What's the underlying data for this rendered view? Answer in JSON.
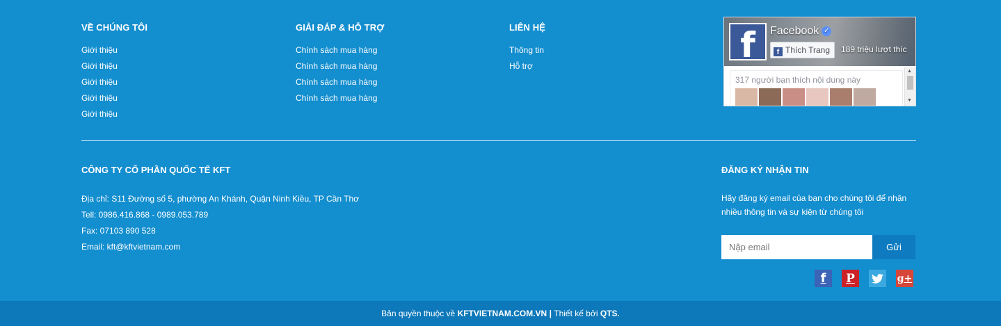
{
  "columns": [
    {
      "title": "VỀ CHÚNG TÔI",
      "links": [
        "Giới thiệu",
        "Giới thiệu",
        "Giới thiệu",
        "Giới thiệu",
        "Giới thiệu"
      ]
    },
    {
      "title": "GIẢI ĐÁP & HỖ TRỢ",
      "links": [
        "Chính sách mua hàng",
        "Chính sách mua hàng",
        "Chính sách mua hàng",
        "Chính sách mua hàng"
      ]
    },
    {
      "title": "LIÊN HỆ",
      "links": [
        "Thông tin",
        "Hỗ trợ"
      ]
    }
  ],
  "facebook": {
    "page_name": "Facebook",
    "like_label": "Thích Trang",
    "likes_text": "189 triệu lượt thíc",
    "friends_text": "317 người bạn thích nội dung này",
    "avatar_colors": [
      "#d9b8a5",
      "#8b6a58",
      "#c98e86",
      "#e7c7c0",
      "#a97e6c",
      "#bfa9a0"
    ]
  },
  "company": {
    "title": "CÔNG TY CỔ PHẦN QUỐC TẾ KFT",
    "address": "Địa chỉ: S11 Đường số 5, phường An Khánh, Quận Ninh Kiều, TP Cần Thơ",
    "tel": "Tell: 0986.416.868 - 0989.053.789",
    "fax": "Fax: 07103 890 528",
    "email": "Email: kft@kftvietnam.com"
  },
  "newsletter": {
    "title": "ĐĂNG KÝ NHẬN TIN",
    "description": "Hãy đăng ký email của bạn cho chúng tôi để nhận nhiều thông tin và sự kiện từ chúng tôi",
    "email_placeholder": "Nập email",
    "submit_label": "Gửi"
  },
  "socials": [
    {
      "name": "facebook-icon",
      "glyph": "f",
      "color": "#3b63b6"
    },
    {
      "name": "pinterest-icon",
      "glyph": "P",
      "color": "#cc2127"
    },
    {
      "name": "twitter-icon",
      "glyph": "",
      "color": "#3ba9e0"
    },
    {
      "name": "google-plus-icon",
      "glyph": "g+",
      "color": "#d6473a"
    }
  ],
  "copyright": {
    "prefix": "Bản quyền thuộc về ",
    "site": "KFTVIETNAM.COM.VN",
    "separator": " | ",
    "designed_by_prefix": "Thiết kế bởi ",
    "designer": "QTS."
  },
  "colors": {
    "background": "#138ecf",
    "bottom_bar": "#0d78ba",
    "button": "#0e7bc0"
  }
}
